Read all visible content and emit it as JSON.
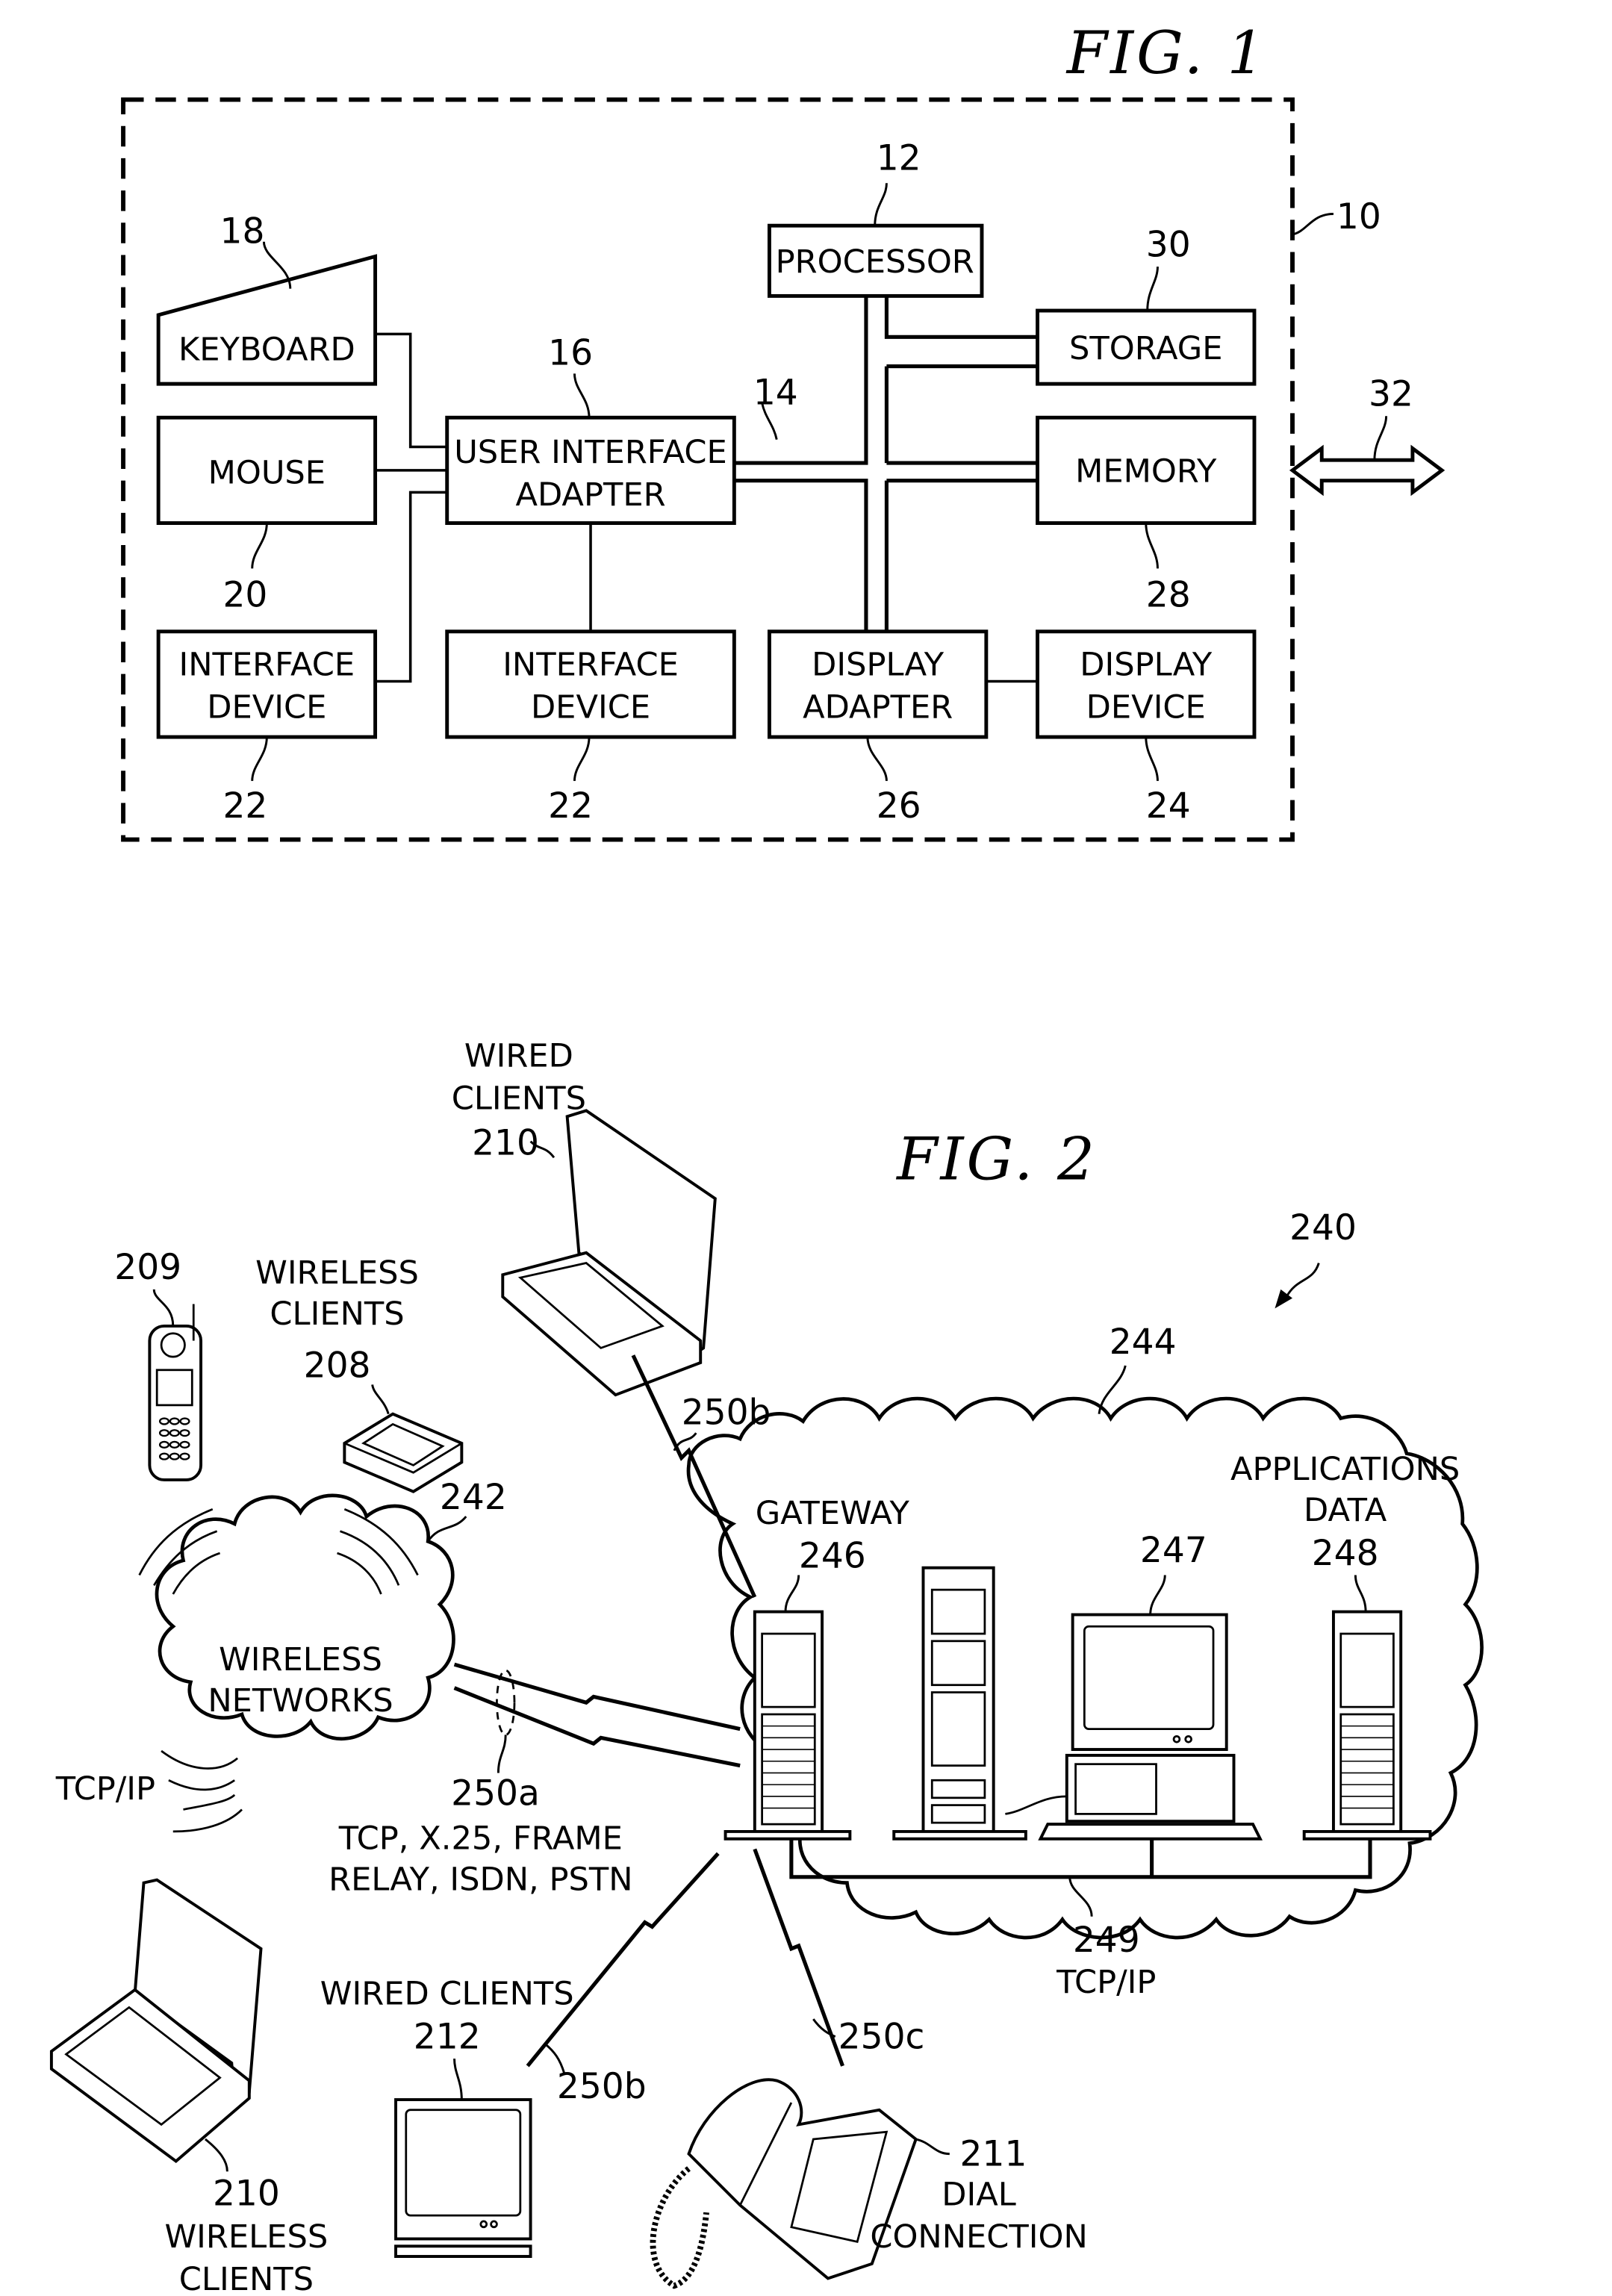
{
  "fig1": {
    "title": "FIG.  1",
    "system_ref": "10",
    "bus_ref": "14",
    "io_arrow_ref": "32",
    "blocks": {
      "processor": {
        "label": "PROCESSOR",
        "ref": "12"
      },
      "storage": {
        "label": "STORAGE",
        "ref": "30"
      },
      "memory": {
        "label": "MEMORY",
        "ref": "28"
      },
      "keyboard": {
        "label": "KEYBOARD",
        "ref": "18"
      },
      "mouse": {
        "label": "MOUSE",
        "ref": "20"
      },
      "ui_adapter": {
        "line1": "USER  INTERFACE",
        "line2": "ADAPTER",
        "ref": "16"
      },
      "interface_device_left": {
        "line1": "INTERFACE",
        "line2": "DEVICE",
        "ref": "22"
      },
      "interface_device_center": {
        "line1": "INTERFACE",
        "line2": "DEVICE",
        "ref": "22"
      },
      "display_adapter": {
        "line1": "DISPLAY",
        "line2": "ADAPTER",
        "ref": "26"
      },
      "display_device": {
        "line1": "DISPLAY",
        "line2": "DEVICE",
        "ref": "24"
      }
    }
  },
  "fig2": {
    "title": "FIG.  2",
    "system_ref": "240",
    "network_cloud_ref": "244",
    "wireless_networks": {
      "line1": "WIRELESS",
      "line2": "NETWORKS",
      "ref": "242"
    },
    "wired_clients_top": {
      "line1": "WIRED",
      "line2": "CLIENTS",
      "ref": "210"
    },
    "phone": {
      "ref": "209"
    },
    "wireless_clients_pda": {
      "line1": "WIRELESS",
      "line2": "CLIENTS",
      "ref": "208"
    },
    "gateway": {
      "label": "GATEWAY",
      "ref": "246"
    },
    "workstation": {
      "ref": "247"
    },
    "app_data": {
      "line1": "APPLICATIONS",
      "line2": "DATA",
      "ref": "248"
    },
    "lan": {
      "ref": "249",
      "protocol": "TCP/IP"
    },
    "tcpip_label": "TCP/IP",
    "link_250a": {
      "ref": "250a",
      "line1": "TCP,  X.25,  FRAME",
      "line2": "RELAY,  ISDN,  PSTN"
    },
    "link_250b_top": "250b",
    "link_250b_bottom": "250b",
    "link_250c": "250c",
    "wireless_laptop": {
      "ref": "210",
      "line1": "WIRELESS",
      "line2": "CLIENTS"
    },
    "wired_clients_bottom": {
      "label": "WIRED  CLIENTS",
      "ref": "212"
    },
    "dial": {
      "ref": "211",
      "line1": "DIAL",
      "line2": "CONNECTION"
    }
  }
}
